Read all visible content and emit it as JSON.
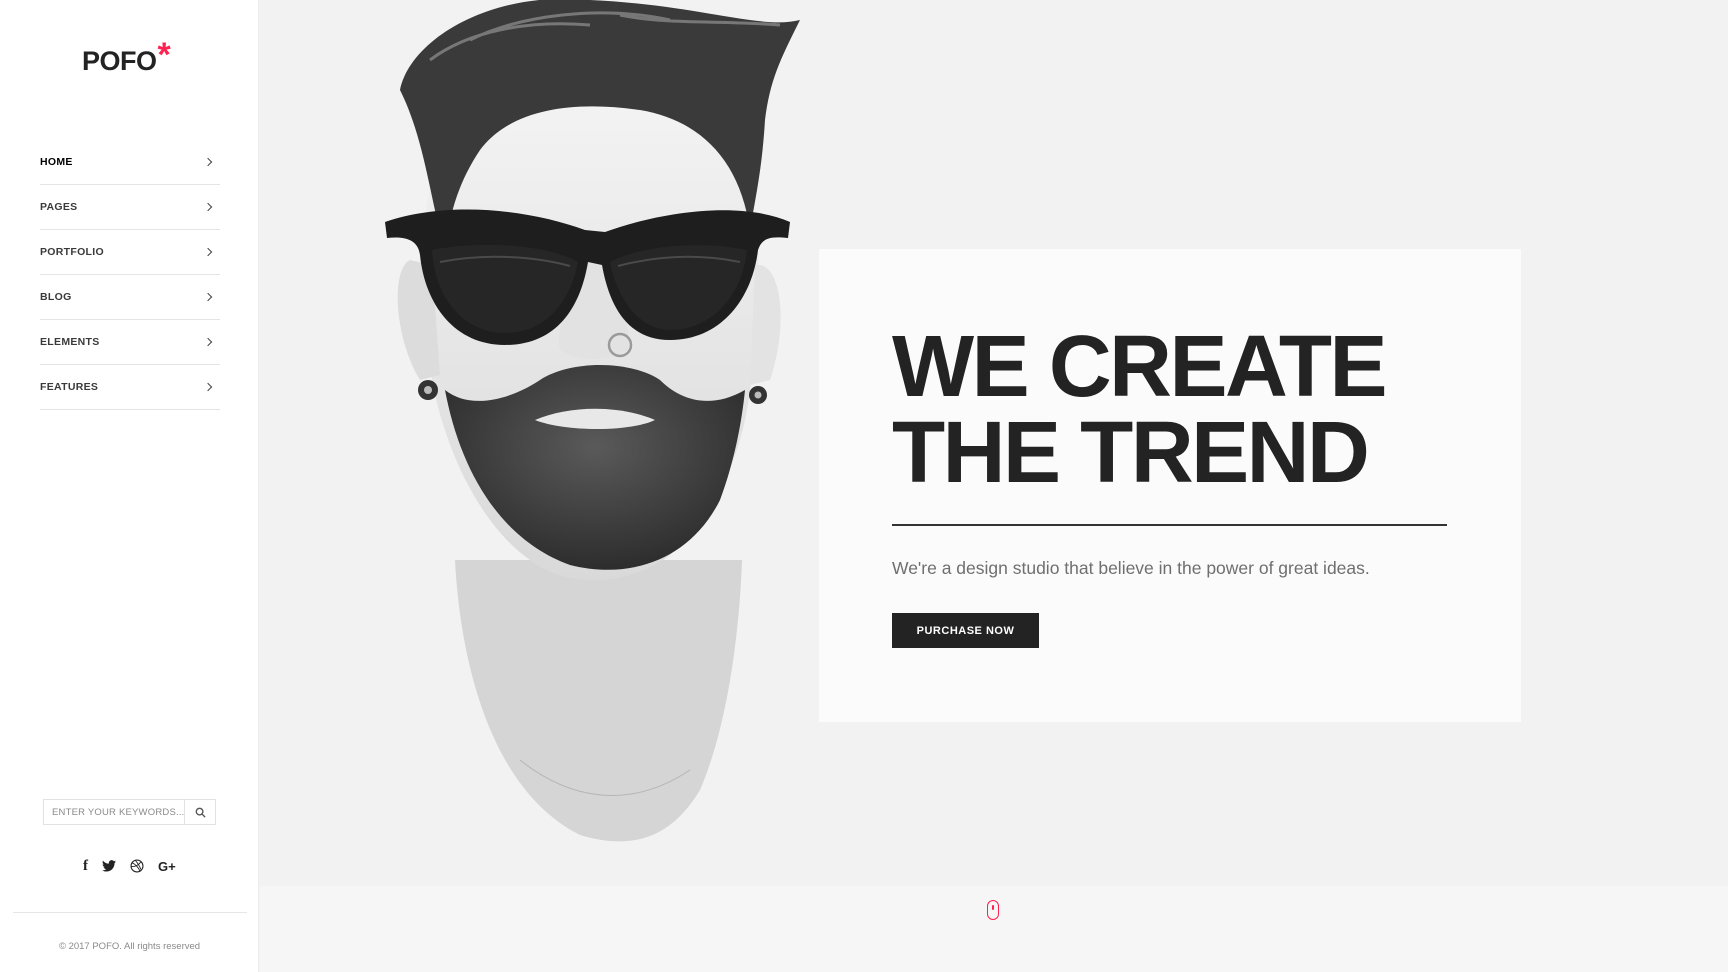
{
  "brand": {
    "name": "POFO",
    "mark": "*",
    "accent_color": "#ff214f"
  },
  "nav": {
    "items": [
      {
        "label": "HOME",
        "icon": "chevron-right-icon",
        "active": true
      },
      {
        "label": "PAGES",
        "icon": "chevron-right-icon",
        "active": false
      },
      {
        "label": "PORTFOLIO",
        "icon": "chevron-right-icon",
        "active": false
      },
      {
        "label": "BLOG",
        "icon": "chevron-right-icon",
        "active": false
      },
      {
        "label": "ELEMENTS",
        "icon": "chevron-right-icon",
        "active": false
      },
      {
        "label": "FEATURES",
        "icon": "chevron-right-icon",
        "active": false
      }
    ]
  },
  "search": {
    "placeholder": "ENTER YOUR KEYWORDS...",
    "value": "",
    "icon": "search-icon"
  },
  "social": {
    "facebook": "f",
    "twitter": "twitter-icon",
    "dribbble": "dribbble-icon",
    "google_plus": "G+"
  },
  "footer": {
    "copyright": "© 2017 POFO. All rights reserved"
  },
  "hero": {
    "headline_line1": "WE CREATE",
    "headline_line2": "THE TREND",
    "tagline": "We're a design studio that believe in the power of great ideas.",
    "cta_label": "PURCHASE NOW",
    "image": "portrait-man-sunglasses",
    "scroll_icon": "mouse-scroll-icon"
  },
  "colors": {
    "dark": "#232323",
    "hero_bg": "#f2f2f2",
    "card_bg": "#fbfbfb"
  }
}
